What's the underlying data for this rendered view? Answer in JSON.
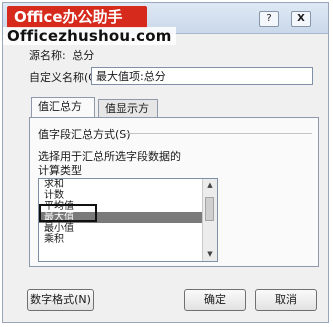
{
  "window": {
    "brand": "Office办公助手",
    "watermark": "Officezhushou.com",
    "help_label": "?",
    "close_label": "X"
  },
  "source": {
    "label": "源名称:",
    "value": "总分"
  },
  "custom_name": {
    "label": "自定义名称(C):",
    "value": "最大值项:总分"
  },
  "tabs": [
    {
      "label": "值汇总方式",
      "selected": true
    },
    {
      "label": "值显示方式",
      "selected": false
    }
  ],
  "panel": {
    "section_title": "值字段汇总方式(S)",
    "description": "选择用于汇总所选字段数据的",
    "calc_type_label": "计算类型",
    "items": [
      "求和",
      "计数",
      "平均值",
      "最大值",
      "最小值",
      "乘积"
    ],
    "selected_item": "最大值"
  },
  "buttons": {
    "number_format": "数字格式(N)",
    "ok": "确定",
    "cancel": "取消"
  }
}
